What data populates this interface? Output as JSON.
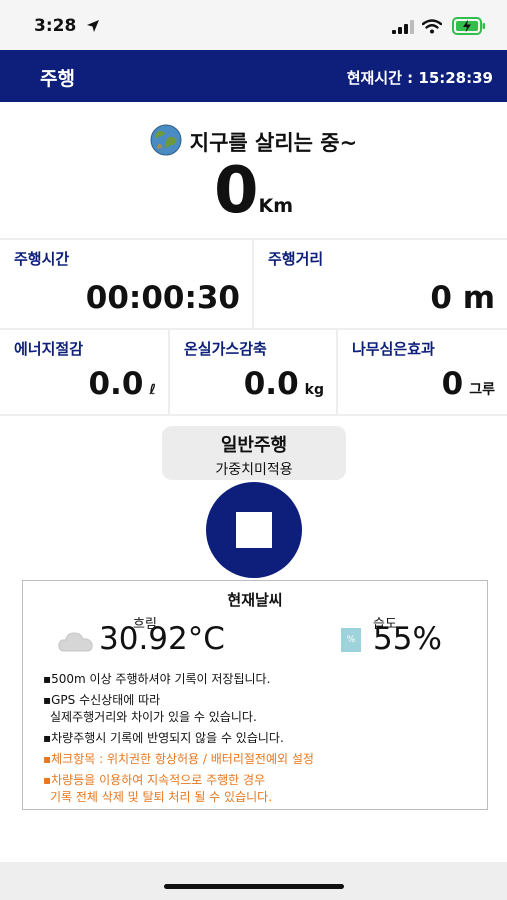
{
  "status_bar": {
    "time": "3:28",
    "icons": [
      "location-arrow-icon",
      "signal-icon",
      "wifi-icon",
      "battery-charging-icon"
    ]
  },
  "header": {
    "title": "주행",
    "clock": "현재시간 : 15:28:39"
  },
  "hero": {
    "slogan": "지구를 살리는 중~",
    "distance": "0",
    "distance_unit": "Km",
    "icon": "earth-globe-icon"
  },
  "stats": {
    "time": {
      "label": "주행시간",
      "value": "00:00:30"
    },
    "distance": {
      "label": "주행거리",
      "value": "0 m"
    },
    "energy": {
      "label": "에너지절감",
      "value": "0.0",
      "unit": "ℓ"
    },
    "ghg": {
      "label": "온실가스감축",
      "value": "0.0",
      "unit": "kg"
    },
    "tree": {
      "label": "나무심은효과",
      "value": "0",
      "unit": "그루"
    }
  },
  "mode": {
    "title": "일반주행",
    "subtitle": "가중치미적용"
  },
  "stop_button": {
    "icon": "stop-square-icon"
  },
  "weather": {
    "title": "현재날씨",
    "condition": "흐림",
    "temperature": "30.92°C",
    "humidity_label": "습도",
    "humidity_icon_text": "%",
    "humidity": "55%",
    "notes": [
      {
        "lines": [
          "▪500m 이상 주행하셔야 기록이 저장됩니다."
        ],
        "color": "#111111"
      },
      {
        "lines": [
          "▪GPS 수신상태에 따라",
          "실제주행거리와 차이가 있을 수 있습니다."
        ],
        "color": "#111111"
      },
      {
        "lines": [
          "▪차량주행시 기록에 반영되지 않을 수 있습니다."
        ],
        "color": "#111111"
      },
      {
        "lines": [
          "▪체크항목 : 위치권한 항상허용 / 배터리절전예외 설정"
        ],
        "color": "#e8771e"
      },
      {
        "lines": [
          "▪차량등을 이용하여 지속적으로 주행한 경우",
          "기록 전체 삭제 및 탈퇴 처리 될 수 있습니다."
        ],
        "color": "#e8771e"
      }
    ]
  },
  "colors": {
    "header_bg": "#0d1f7a",
    "accent_label": "#0d1f7a",
    "warning": "#e8771e",
    "humidity_icon": "#9ed3dc"
  }
}
